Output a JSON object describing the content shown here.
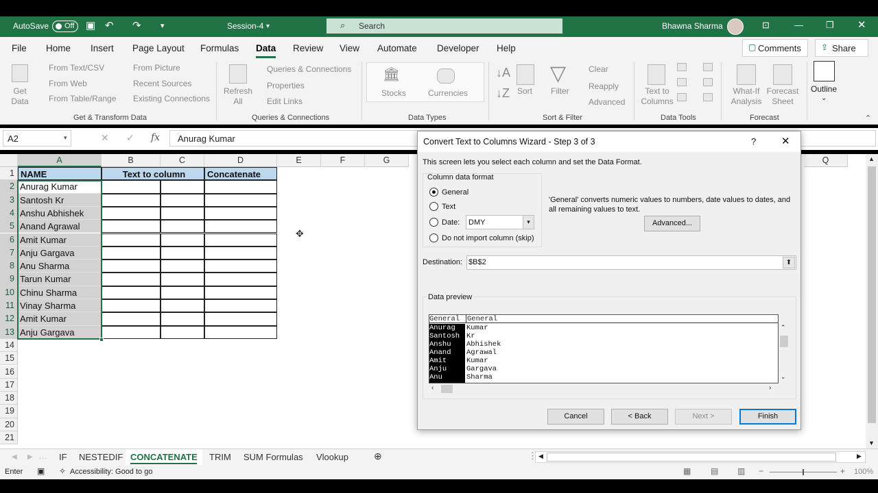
{
  "titlebar": {
    "autosave_label": "AutoSave",
    "autosave_state": "Off",
    "doc_title": "Session-4",
    "search_placeholder": "Search",
    "user_name": "Bhawna Sharma"
  },
  "ribbon_tabs": [
    "File",
    "Home",
    "Insert",
    "Page Layout",
    "Formulas",
    "Data",
    "Review",
    "View",
    "Automate",
    "Developer",
    "Help"
  ],
  "active_tab": "Data",
  "comments_label": "Comments",
  "share_label": "Share",
  "ribbon": {
    "get_data": "Get Data",
    "from_text_csv": "From Text/CSV",
    "from_web": "From Web",
    "from_table_range": "From Table/Range",
    "from_picture": "From Picture",
    "recent_sources": "Recent Sources",
    "existing_connections": "Existing Connections",
    "group_get_transform": "Get & Transform Data",
    "refresh_all": "Refresh All",
    "queries_connections": "Queries & Connections",
    "properties": "Properties",
    "edit_links": "Edit Links",
    "group_queries": "Queries & Connections",
    "stocks": "Stocks",
    "currencies": "Currencies",
    "group_data_types": "Data Types",
    "sort": "Sort",
    "filter": "Filter",
    "clear": "Clear",
    "reapply": "Reapply",
    "advanced": "Advanced",
    "group_sort_filter": "Sort & Filter",
    "text_to_columns": "Text to Columns",
    "group_data_tools": "Data Tools",
    "what_if": "What-If Analysis",
    "forecast_sheet": "Forecast Sheet",
    "group_forecast": "Forecast",
    "outline": "Outline"
  },
  "formula_bar": {
    "name_box": "A2",
    "fx": "fx",
    "value": "Anurag Kumar"
  },
  "columns": [
    "A",
    "B",
    "C",
    "D",
    "E",
    "F",
    "G",
    "Q"
  ],
  "rows": [
    "1",
    "2",
    "3",
    "4",
    "5",
    "6",
    "7",
    "8",
    "9",
    "10",
    "11",
    "12",
    "13",
    "14",
    "15",
    "16",
    "17",
    "18",
    "19",
    "20",
    "21"
  ],
  "headers": {
    "a1": "NAME",
    "b1": "Text to column",
    "d1": "Concatenate"
  },
  "names": [
    "Anurag Kumar",
    "Santosh Kr",
    "Anshu Abhishek",
    "Anand Agrawal",
    "Amit Kumar",
    "Anju Gargava",
    "Anu Sharma",
    "Tarun Kumar",
    "Chinu Sharma",
    "Vinay Sharma",
    "Amit Kumar",
    "Anju Gargava"
  ],
  "dialog": {
    "title": "Convert Text to Columns Wizard - Step 3 of 3",
    "help": "?",
    "intro": "This screen lets you select each column and set the Data Format.",
    "format_group": "Column data format",
    "opt_general": "General",
    "opt_text": "Text",
    "opt_date": "Date:",
    "date_value": "DMY",
    "opt_skip": "Do not import column (skip)",
    "description": "'General' converts numeric values to numbers, date values to dates, and all remaining values to text.",
    "advanced_btn": "Advanced...",
    "destination_label": "Destination:",
    "destination_value": "$B$2",
    "preview_label": "Data preview",
    "preview_headers": [
      "General",
      "General"
    ],
    "preview_col1": [
      "Anurag",
      "Santosh",
      "Anshu",
      "Anand",
      "Amit",
      "Anju",
      "Anu"
    ],
    "preview_col2": [
      "Kumar",
      "Kr",
      "Abhishek",
      "Agrawal",
      "Kumar",
      "Gargava",
      "Sharma"
    ],
    "cancel": "Cancel",
    "back": "< Back",
    "next": "Next >",
    "finish": "Finish"
  },
  "sheet_tabs": [
    "IF",
    "NESTEDIF",
    "CONCATENATE",
    "TRIM",
    "SUM Formulas",
    "Vlookup"
  ],
  "active_sheet": "CONCATENATE",
  "status": {
    "mode": "Enter",
    "accessibility": "Accessibility: Good to go",
    "zoom": "100%"
  },
  "colors": {
    "excel_green": "#217346",
    "header_fill": "#bdd7ee",
    "selection": "#d2d2d2"
  }
}
